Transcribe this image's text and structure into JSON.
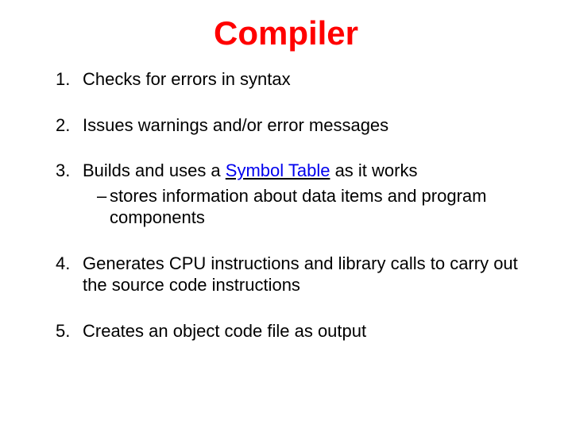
{
  "title": "Compiler",
  "items": [
    {
      "text": "Checks for errors in syntax"
    },
    {
      "text": "Issues warnings and/or error messages"
    },
    {
      "prefix": "Builds and uses a ",
      "blue": "Symbol Table",
      "suffix": " as it works",
      "sub": "stores information about data items and program components"
    },
    {
      "text": "Generates CPU instructions and library calls to carry out the source code instructions"
    },
    {
      "text": "Creates an object code file as output"
    }
  ]
}
